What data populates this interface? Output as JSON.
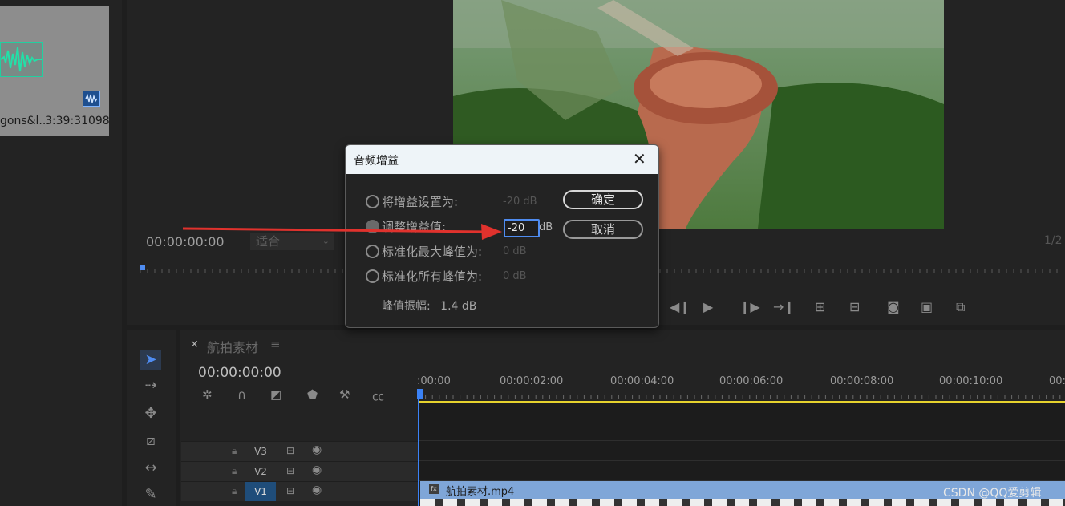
{
  "project_panel": {
    "clip_name": "gons&l...",
    "clip_duration": "3:39:31098"
  },
  "program_monitor": {
    "timecode": "00:00:00:00",
    "fit_label": "适合",
    "page_indicator": "1/2"
  },
  "timeline": {
    "sequence_name": "航拍素材",
    "sequence_close": "×",
    "menu_glyph": "≡",
    "timecode": "00:00:00:00",
    "ruler_labels": [
      ":00:00",
      "00:00:02:00",
      "00:00:04:00",
      "00:00:06:00",
      "00:00:08:00",
      "00:00:10:00",
      "00:"
    ],
    "tracks": [
      {
        "name": "V3"
      },
      {
        "name": "V2"
      },
      {
        "name": "V1"
      }
    ],
    "clip_name": "航拍素材.mp4",
    "clip_fx": "fx"
  },
  "dialog": {
    "title": "音频增益",
    "close_glyph": "✕",
    "options": [
      {
        "label": "将增益设置为:",
        "value": "-20 dB"
      },
      {
        "label": "调整增益值:",
        "value": "-20",
        "unit": "dB"
      },
      {
        "label": "标准化最大峰值为:",
        "value": "0 dB"
      },
      {
        "label": "标准化所有峰值为:",
        "value": "0 dB"
      }
    ],
    "peak_label": "峰值振幅:",
    "peak_value": "1.4 dB",
    "ok_label": "确定",
    "cancel_label": "取消",
    "selected_option": 1
  },
  "watermark": "CSDN @QQ爱剪辑",
  "colors": {
    "accent": "#4f8cf0",
    "arrow": "#e0322d",
    "work_area": "#e6d22d",
    "clip": "#7fa6d8"
  }
}
